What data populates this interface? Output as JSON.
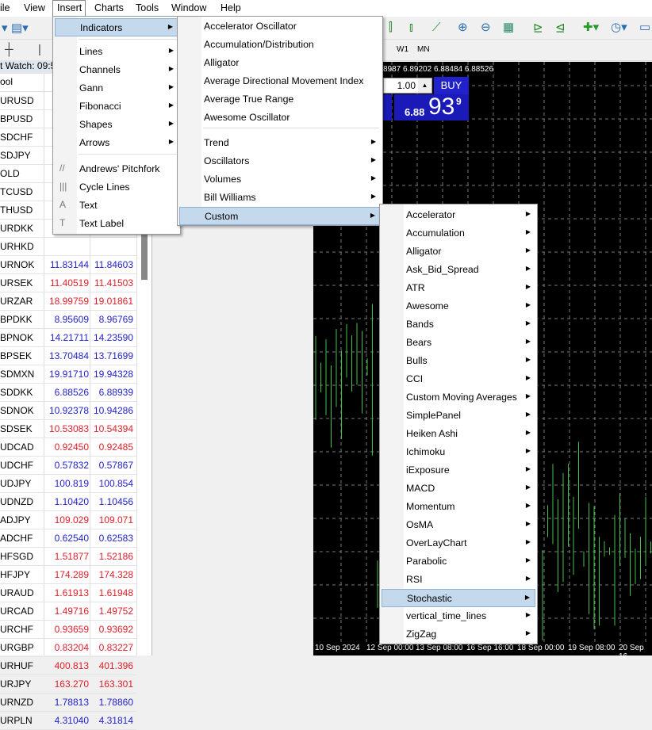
{
  "menubar": {
    "items": [
      "ile",
      "View",
      "Insert",
      "Charts",
      "Tools",
      "Window",
      "Help"
    ]
  },
  "timeframes": {
    "w1": "W1",
    "mn": "MN"
  },
  "market_watch": {
    "title": "t Watch: 09:5",
    "col_symbol": "ool",
    "rows": [
      {
        "s": "URUSD",
        "b": "",
        "a": "",
        "c": ""
      },
      {
        "s": "BPUSD",
        "b": "",
        "a": "",
        "c": ""
      },
      {
        "s": "SDCHF",
        "b": "",
        "a": "",
        "c": ""
      },
      {
        "s": "SDJPY",
        "b": "",
        "a": "",
        "c": ""
      },
      {
        "s": "OLD",
        "b": "",
        "a": "",
        "c": ""
      },
      {
        "s": "TCUSD",
        "b": "",
        "a": "",
        "c": ""
      },
      {
        "s": "THUSD",
        "b": "",
        "a": "",
        "c": ""
      },
      {
        "s": "URDKK",
        "b": "",
        "a": "",
        "c": ""
      },
      {
        "s": "URHKD",
        "b": "",
        "a": "",
        "c": ""
      },
      {
        "s": "URNOK",
        "b": "11.83144",
        "a": "11.84603",
        "c": "blue"
      },
      {
        "s": "URSEK",
        "b": "11.40519",
        "a": "11.41503",
        "c": "red"
      },
      {
        "s": "URZAR",
        "b": "18.99759",
        "a": "19.01861",
        "c": "red"
      },
      {
        "s": "BPDKK",
        "b": "8.95609",
        "a": "8.96769",
        "c": "blue"
      },
      {
        "s": "BPNOK",
        "b": "14.21711",
        "a": "14.23590",
        "c": "blue"
      },
      {
        "s": "BPSEK",
        "b": "13.70484",
        "a": "13.71699",
        "c": "blue"
      },
      {
        "s": "SDMXN",
        "b": "19.91710",
        "a": "19.94328",
        "c": "blue"
      },
      {
        "s": "SDDKK",
        "b": "6.88526",
        "a": "6.88939",
        "c": "blue"
      },
      {
        "s": "SDNOK",
        "b": "10.92378",
        "a": "10.94286",
        "c": "blue"
      },
      {
        "s": "SDSEK",
        "b": "10.53083",
        "a": "10.54394",
        "c": "red"
      },
      {
        "s": "UDCAD",
        "b": "0.92450",
        "a": "0.92485",
        "c": "red"
      },
      {
        "s": "UDCHF",
        "b": "0.57832",
        "a": "0.57867",
        "c": "blue"
      },
      {
        "s": "UDJPY",
        "b": "100.819",
        "a": "100.854",
        "c": "blue"
      },
      {
        "s": "UDNZD",
        "b": "1.10420",
        "a": "1.10456",
        "c": "blue"
      },
      {
        "s": "ADJPY",
        "b": "109.029",
        "a": "109.071",
        "c": "red"
      },
      {
        "s": "ADCHF",
        "b": "0.62540",
        "a": "0.62583",
        "c": "blue"
      },
      {
        "s": "HFSGD",
        "b": "1.51877",
        "a": "1.52186",
        "c": "red"
      },
      {
        "s": "HFJPY",
        "b": "174.289",
        "a": "174.328",
        "c": "red"
      },
      {
        "s": "URAUD",
        "b": "1.61913",
        "a": "1.61948",
        "c": "red"
      },
      {
        "s": "URCAD",
        "b": "1.49716",
        "a": "1.49752",
        "c": "red"
      },
      {
        "s": "URCHF",
        "b": "0.93659",
        "a": "0.93692",
        "c": "red"
      },
      {
        "s": "URGBP",
        "b": "0.83204",
        "a": "0.83227",
        "c": "red"
      },
      {
        "s": "URHUF",
        "b": "400.813",
        "a": "401.396",
        "c": "red"
      },
      {
        "s": "URJPY",
        "b": "163.270",
        "a": "163.301",
        "c": "red"
      },
      {
        "s": "URNZD",
        "b": "1.78813",
        "a": "1.78860",
        "c": "blue"
      },
      {
        "s": "URPLN",
        "b": "4.31040",
        "a": "4.31814",
        "c": "blue"
      }
    ]
  },
  "colors": {
    "blue": "#2222cc",
    "red": "#e0202a",
    "chart_bg": "#000000",
    "bar": "#3fc24a",
    "highlight": "#c5d9ec"
  },
  "chart": {
    "info": "8987 6.89202 6.88484 6.88526",
    "lot": "1.00",
    "buy": "BUY",
    "price_small": "6.88",
    "price_big": "93",
    "price_sup": "9",
    "dates": [
      "10 Sep 2024",
      "12 Sep 00:00",
      "13 Sep 08:00",
      "16 Sep 16:00",
      "18 Sep 00:00",
      "19 Sep 08:00",
      "20 Sep 16"
    ]
  },
  "insert_menu": {
    "items": [
      {
        "label": "Indicators",
        "sub": true,
        "hl": true
      },
      {
        "label": "Lines",
        "sub": true
      },
      {
        "label": "Channels",
        "sub": true
      },
      {
        "label": "Gann",
        "sub": true
      },
      {
        "label": "Fibonacci",
        "sub": true
      },
      {
        "label": "Shapes",
        "sub": true
      },
      {
        "label": "Arrows",
        "sub": true
      },
      {
        "label": "Andrews' Pitchfork",
        "icon": "pitchfork-icon",
        "g": "//"
      },
      {
        "label": "Cycle Lines",
        "icon": "cycle-lines-icon",
        "g": "|||"
      },
      {
        "label": "Text",
        "icon": "text-icon",
        "g": "A"
      },
      {
        "label": "Text Label",
        "icon": "text-label-icon",
        "g": "T"
      }
    ]
  },
  "indicators_menu": {
    "items": [
      {
        "label": "Accelerator Oscillator"
      },
      {
        "label": "Accumulation/Distribution"
      },
      {
        "label": "Alligator"
      },
      {
        "label": "Average Directional Movement Index"
      },
      {
        "label": "Average True Range"
      },
      {
        "label": "Awesome Oscillator"
      },
      {
        "label": "Trend",
        "sub": true
      },
      {
        "label": "Oscillators",
        "sub": true
      },
      {
        "label": "Volumes",
        "sub": true
      },
      {
        "label": "Bill Williams",
        "sub": true
      },
      {
        "label": "Custom",
        "sub": true,
        "hl": true
      }
    ]
  },
  "custom_menu": {
    "items": [
      "Accelerator",
      "Accumulation",
      "Alligator",
      "Ask_Bid_Spread",
      "ATR",
      "Awesome",
      "Bands",
      "Bears",
      "Bulls",
      "CCI",
      "Custom Moving Averages",
      "SimplePanel",
      "Heiken Ashi",
      "Ichimoku",
      "iExposure",
      "MACD",
      "Momentum",
      "OsMA",
      "OverLayChart",
      "Parabolic",
      "RSI",
      "Stochastic",
      "vertical_time_lines",
      "ZigZag"
    ],
    "selected": "Stochastic"
  }
}
